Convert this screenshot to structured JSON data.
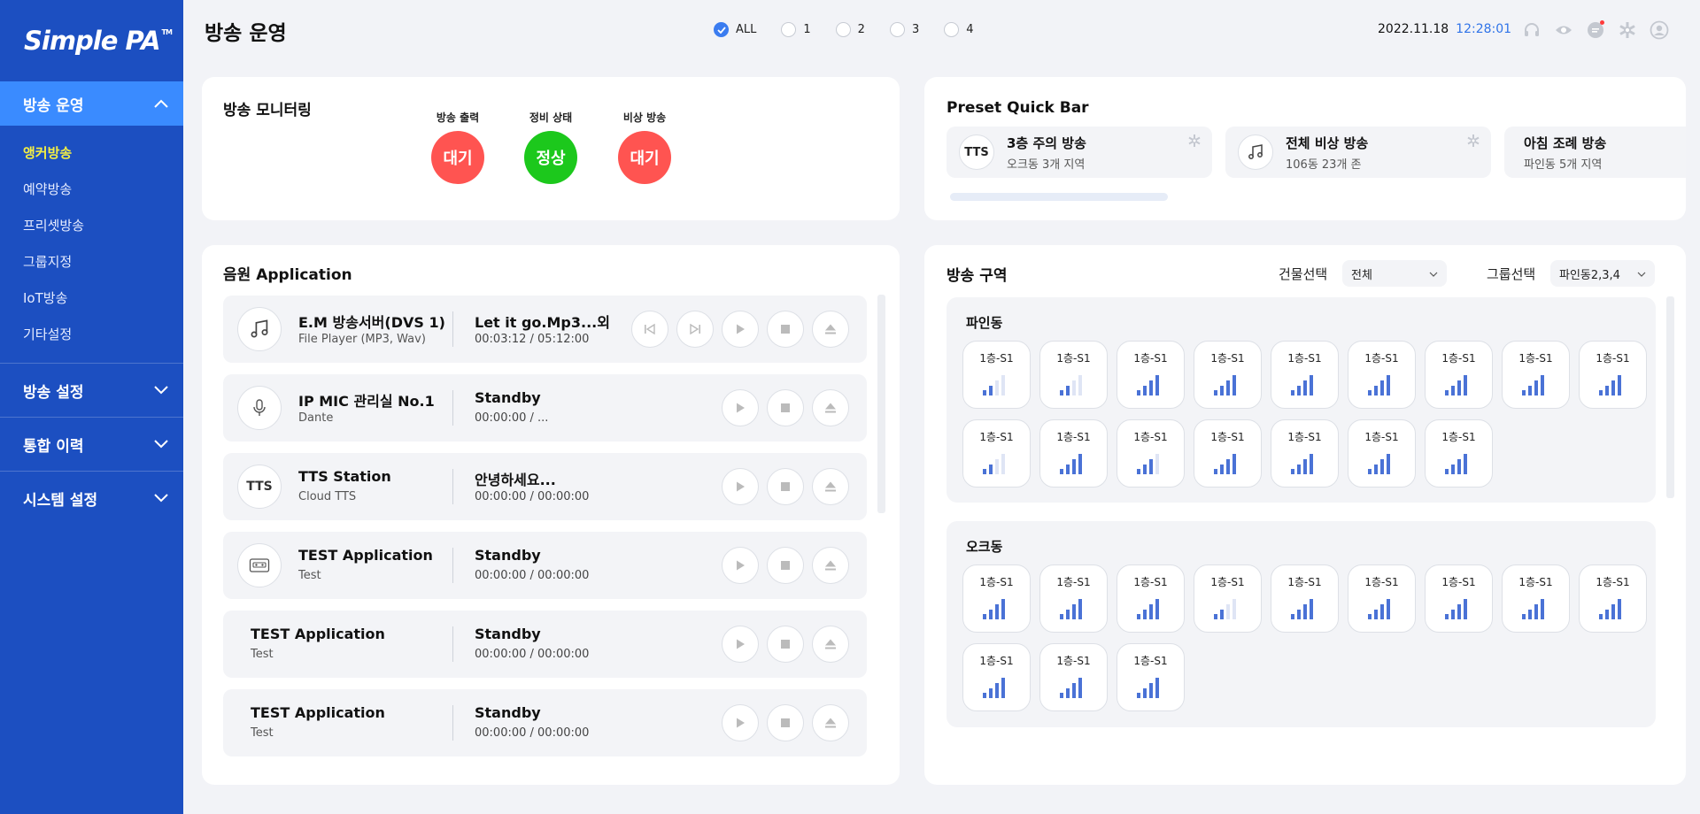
{
  "sidebar": {
    "logo": "Simple PA",
    "logo_tm": "TM",
    "main_item": "방송 운영",
    "sub_items": [
      {
        "label": "앵커방송",
        "active": true
      },
      {
        "label": "예약방송",
        "active": false
      },
      {
        "label": "프리셋방송",
        "active": false
      },
      {
        "label": "그룹지정",
        "active": false
      },
      {
        "label": "IoT방송",
        "active": false
      },
      {
        "label": "기타설정",
        "active": false
      }
    ],
    "groups": [
      "방송 설정",
      "통합 이력",
      "시스템 설정"
    ]
  },
  "header": {
    "title": "방송 운영",
    "filters": [
      {
        "label": "ALL",
        "checked": true
      },
      {
        "label": "1",
        "checked": false
      },
      {
        "label": "2",
        "checked": false
      },
      {
        "label": "3",
        "checked": false
      },
      {
        "label": "4",
        "checked": false
      }
    ],
    "date": "2022.11.18",
    "time": "12:28:01",
    "icons": [
      "headset-icon",
      "eye-icon",
      "chat-icon",
      "settings-icon",
      "user-icon"
    ]
  },
  "monitoring": {
    "title": "방송 모니터링",
    "items": [
      {
        "label": "방송 출력",
        "status": "대기",
        "color": "#ff5451"
      },
      {
        "label": "정비 상태",
        "status": "정상",
        "color": "#1cc81c"
      },
      {
        "label": "비상 방송",
        "status": "대기",
        "color": "#ff5451"
      }
    ]
  },
  "preset": {
    "title": "Preset Quick Bar",
    "items": [
      {
        "icon": "TTS",
        "title": "3층 주의 방송",
        "sub": "오크동 3개 지역"
      },
      {
        "icon": "music-note-icon",
        "title": "전체 비상 방송",
        "sub": "106동 23개 존"
      },
      {
        "icon": "",
        "title": "아침 조례 방송",
        "sub": "파인동 5개 지역"
      }
    ]
  },
  "apps": {
    "title": "음원 Application",
    "rows": [
      {
        "icon": "music-note-icon",
        "name": "E.M 방송서버(DVS 1)",
        "type": "File Player (MP3, Wav)",
        "track": "Let it go.Mp3...외",
        "time": "00:03:12 / 05:12:00",
        "controls": [
          "prev",
          "next",
          "play",
          "stop",
          "eject"
        ]
      },
      {
        "icon": "microphone-icon",
        "name": "IP MIC 관리실 No.1",
        "type": "Dante",
        "track": "Standby",
        "time": "00:00:00 / ...",
        "controls": [
          "play",
          "stop",
          "eject"
        ]
      },
      {
        "icon": "TTS",
        "name": "TTS Station",
        "type": "Cloud TTS",
        "track": "안녕하세요...",
        "time": "00:00:00 / 00:00:00",
        "controls": [
          "play",
          "stop",
          "eject"
        ]
      },
      {
        "icon": "cassette-icon",
        "name": "TEST Application",
        "type": "Test",
        "track": "Standby",
        "time": "00:00:00 / 00:00:00",
        "controls": [
          "play",
          "stop",
          "eject"
        ]
      },
      {
        "icon": "",
        "name": "TEST Application",
        "type": "Test",
        "track": "Standby",
        "time": "00:00:00 / 00:00:00",
        "controls": [
          "play",
          "stop",
          "eject"
        ]
      },
      {
        "icon": "",
        "name": "TEST Application",
        "type": "Test",
        "track": "Standby",
        "time": "00:00:00 / 00:00:00",
        "controls": [
          "play",
          "stop",
          "eject"
        ]
      }
    ]
  },
  "zones": {
    "title": "방송 구역",
    "building_label": "건물선택",
    "building_value": "전체",
    "group_label": "그룹선택",
    "group_value": "파인동2,3,4",
    "sections": [
      {
        "name": "파인동",
        "tiles": [
          {
            "label": "1층-S1",
            "level": 2
          },
          {
            "label": "1층-S1",
            "level": 2
          },
          {
            "label": "1층-S1",
            "level": 4
          },
          {
            "label": "1층-S1",
            "level": 4
          },
          {
            "label": "1층-S1",
            "level": 4
          },
          {
            "label": "1층-S1",
            "level": 4
          },
          {
            "label": "1층-S1",
            "level": 4
          },
          {
            "label": "1층-S1",
            "level": 4
          },
          {
            "label": "1층-S1",
            "level": 4
          },
          {
            "label": "1층-S1",
            "level": 2
          },
          {
            "label": "1층-S1",
            "level": 4
          },
          {
            "label": "1층-S1",
            "level": 3
          },
          {
            "label": "1층-S1",
            "level": 4
          },
          {
            "label": "1층-S1",
            "level": 4
          },
          {
            "label": "1층-S1",
            "level": 4
          },
          {
            "label": "1층-S1",
            "level": 4
          }
        ]
      },
      {
        "name": "오크동",
        "tiles": [
          {
            "label": "1층-S1",
            "level": 4
          },
          {
            "label": "1층-S1",
            "level": 4
          },
          {
            "label": "1층-S1",
            "level": 4
          },
          {
            "label": "1층-S1",
            "level": 2
          },
          {
            "label": "1층-S1",
            "level": 4
          },
          {
            "label": "1층-S1",
            "level": 4
          },
          {
            "label": "1층-S1",
            "level": 4
          },
          {
            "label": "1층-S1",
            "level": 4
          },
          {
            "label": "1층-S1",
            "level": 4
          },
          {
            "label": "1층-S1",
            "level": 4
          },
          {
            "label": "1층-S1",
            "level": 4
          },
          {
            "label": "1층-S1",
            "level": 4
          }
        ]
      }
    ]
  }
}
